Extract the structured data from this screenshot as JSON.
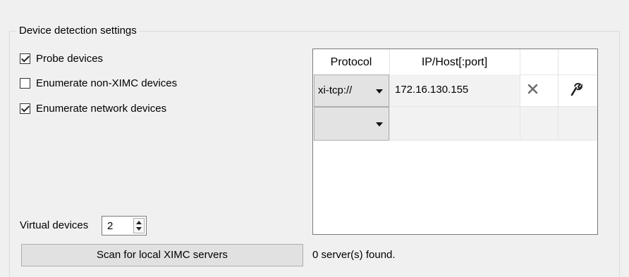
{
  "group": {
    "title": "Device detection settings"
  },
  "options": {
    "probe": {
      "label": "Probe devices",
      "checked": true
    },
    "enumerate_non_ximc": {
      "label": "Enumerate non-XIMC devices",
      "checked": false
    },
    "enumerate_network": {
      "label": "Enumerate network devices",
      "checked": true
    }
  },
  "table": {
    "columns": [
      "Protocol",
      "IP/Host[:port]"
    ],
    "rows": [
      {
        "protocol": "xi-tcp://",
        "host": "172.16.130.155"
      },
      {
        "protocol": "",
        "host": ""
      }
    ],
    "icons": {
      "remove": "close-icon",
      "edit": "wrench-icon"
    }
  },
  "virtual_devices": {
    "label": "Virtual devices",
    "value": "2"
  },
  "scan": {
    "button_label": "Scan for local XIMC servers",
    "status": "0 server(s) found."
  }
}
